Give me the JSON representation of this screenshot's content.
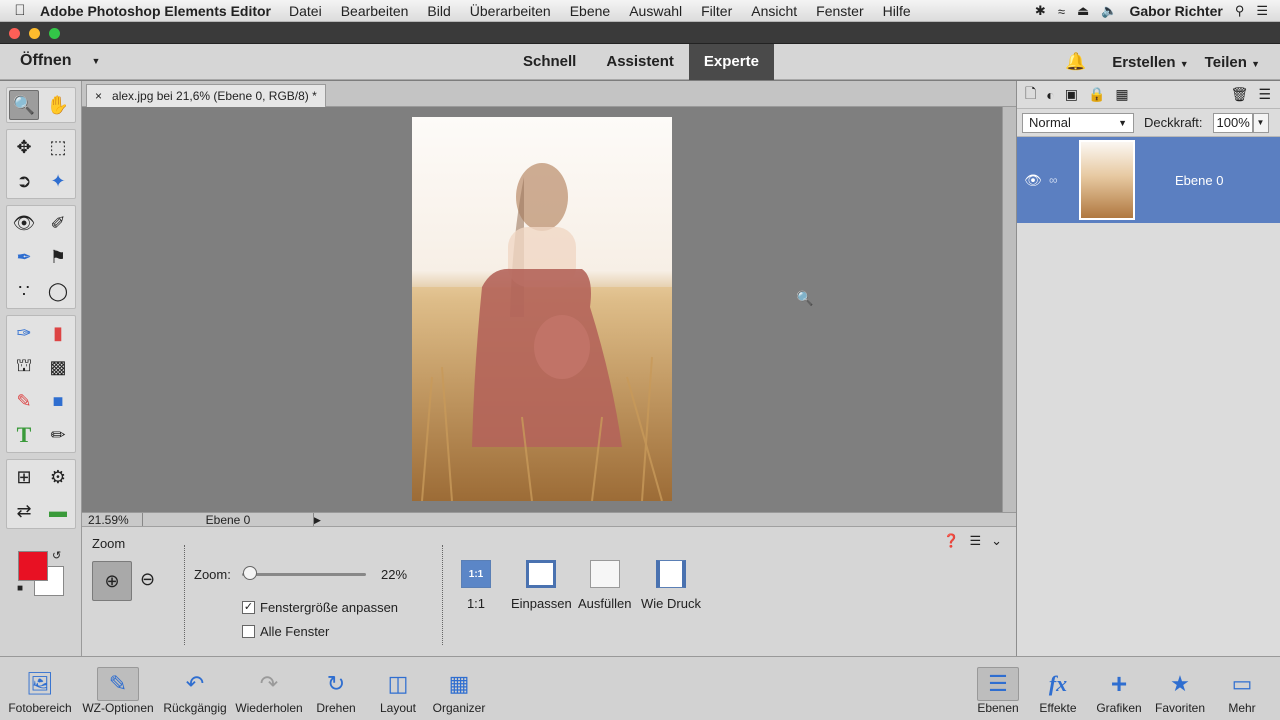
{
  "menubar": {
    "app": "Adobe Photoshop Elements Editor",
    "items": [
      "Datei",
      "Bearbeiten",
      "Bild",
      "Überarbeiten",
      "Ebene",
      "Auswahl",
      "Filter",
      "Ansicht",
      "Fenster",
      "Hilfe"
    ],
    "user": "Gabor Richter"
  },
  "header": {
    "open_label": "Öffnen",
    "modes": [
      "Schnell",
      "Assistent",
      "Experte"
    ],
    "active_mode": "Experte",
    "create_label": "Erstellen",
    "share_label": "Teilen"
  },
  "document": {
    "tab_title": "alex.jpg bei 21,6% (Ebene 0, RGB/8) *",
    "close_glyph": "×"
  },
  "statusbar": {
    "zoom": "21.59%",
    "layer": "Ebene 0"
  },
  "options": {
    "title": "Zoom",
    "zoom_label": "Zoom:",
    "zoom_value": "22%",
    "zoom_fraction": 0.22,
    "fit_window_label": "Fenstergröße anpassen",
    "fit_window_checked": true,
    "all_windows_label": "Alle Fenster",
    "all_windows_checked": false,
    "view_buttons": [
      {
        "label": "1:1",
        "icon_text": "1:1"
      },
      {
        "label": "Einpassen",
        "icon_text": ""
      },
      {
        "label": "Ausfüllen",
        "icon_text": ""
      },
      {
        "label": "Wie Druck",
        "icon_text": ""
      }
    ]
  },
  "layers": {
    "blend_mode": "Normal",
    "opacity_label": "Deckkraft:",
    "opacity_value": "100%",
    "layer_name": "Ebene 0"
  },
  "bottombar": {
    "left": [
      "Fotobereich",
      "WZ-Optionen",
      "Rückgängig",
      "Wiederholen",
      "Drehen",
      "Layout",
      "Organizer"
    ],
    "right": [
      "Ebenen",
      "Effekte",
      "Grafiken",
      "Favoriten",
      "Mehr"
    ]
  },
  "colors": {
    "foreground": "#e81123",
    "background": "#ffffff",
    "selection": "#5b7fc1",
    "accent": "#2f7de0"
  }
}
